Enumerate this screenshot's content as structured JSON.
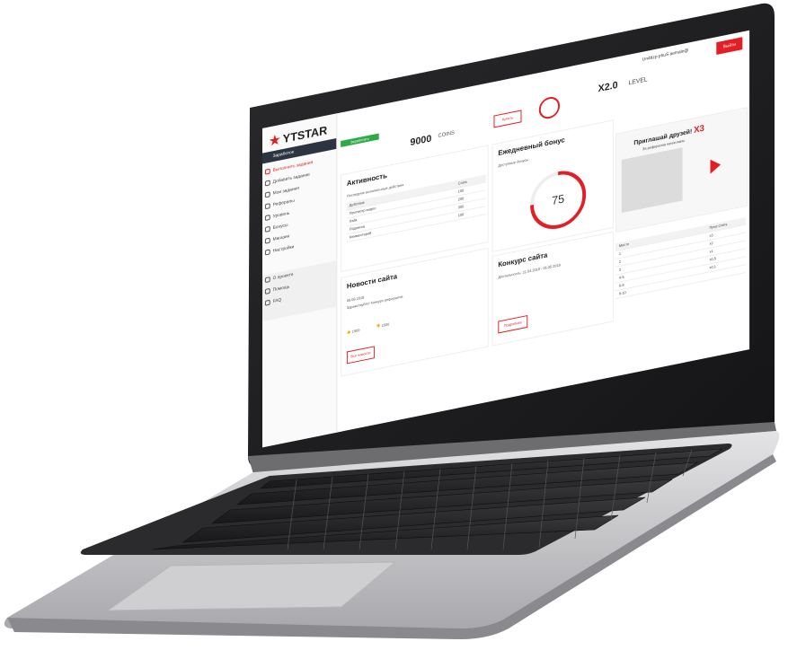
{
  "topbar": {
    "user_name": "Un4ttzp phuS aemaln@",
    "logout_label": "Выйти"
  },
  "sidebar": {
    "logo_text": "YTSTAR",
    "active_item": "Заработок",
    "items": [
      {
        "label": "Выполнить задания",
        "accent": true
      },
      {
        "label": "Добавить задание",
        "accent": false
      },
      {
        "label": "Мои задания",
        "accent": false
      },
      {
        "label": "Рефералы",
        "accent": false
      },
      {
        "label": "Уровень",
        "accent": false
      },
      {
        "label": "Бонусы",
        "accent": false
      },
      {
        "label": "Магазин",
        "accent": false
      },
      {
        "label": "Настройки",
        "accent": false
      }
    ],
    "lower_items": [
      {
        "label": "О проекте"
      },
      {
        "label": "Помощь"
      },
      {
        "label": "FAQ"
      }
    ]
  },
  "coins": {
    "button_label": "Заработать",
    "value": "9000",
    "label": "COINS"
  },
  "level": {
    "button_label": "Купить",
    "value": "X2.0",
    "label": "LEVEL"
  },
  "activity": {
    "title": "Активность",
    "subtitle": "Последние выполненные действия",
    "header": [
      "Действие",
      "Coins"
    ],
    "rows": [
      [
        "Просмотр видео",
        "100"
      ],
      [
        "Лайк",
        "200"
      ],
      [
        "Подписка",
        "300"
      ],
      [
        "Комментарий",
        "100"
      ]
    ]
  },
  "bonus": {
    "title": "Ежедневный бонус",
    "subtitle": "Доступные бонусы",
    "value": "75",
    "fraction": 0.75
  },
  "news": {
    "title": "Новости сайта",
    "date": "05.08.2018",
    "text": "Здравствуйте! Конкурс рефералов",
    "likes": "1500",
    "dislikes": "1500",
    "button_label": "Все новости"
  },
  "contest": {
    "title": "Конкурс сайта",
    "subtitle": "Длительность: 21.04.2018 - 05.05.2018",
    "button_label": "Подробнее",
    "header": [
      "Место",
      "Приз Coins"
    ],
    "rows": [
      [
        "1",
        "x3"
      ],
      [
        "2",
        "x2"
      ],
      [
        "3",
        "x1"
      ],
      [
        "4-5",
        "x0,5"
      ],
      [
        "6-8",
        "x0,1"
      ],
      [
        "9-10",
        ""
      ]
    ]
  },
  "promo": {
    "title": "Приглашай друзей!",
    "multiplier": "X3",
    "subtitle": "За рефералов начисляем"
  },
  "colors": {
    "accent": "#e31e24",
    "green": "#2eaa47",
    "dark": "#2b3440"
  }
}
